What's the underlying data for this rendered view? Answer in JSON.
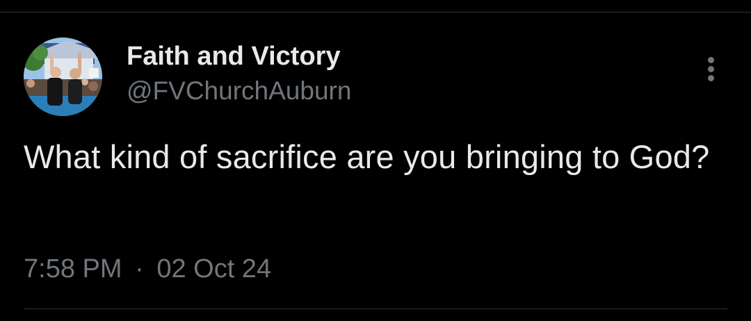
{
  "tweet": {
    "author": {
      "display_name": "Faith and Victory",
      "handle": "@FVChurchAuburn",
      "avatar_icon": "profile-photo"
    },
    "text": "What kind of sacrifice are you bringing to God?",
    "time": "7:58 PM",
    "separator": "·",
    "date": "02 Oct 24",
    "more_icon": "more-vertical-icon"
  },
  "colors": {
    "background": "#000000",
    "text_primary": "#e7e9ea",
    "text_secondary": "#71767b",
    "divider": "#2f3336"
  }
}
